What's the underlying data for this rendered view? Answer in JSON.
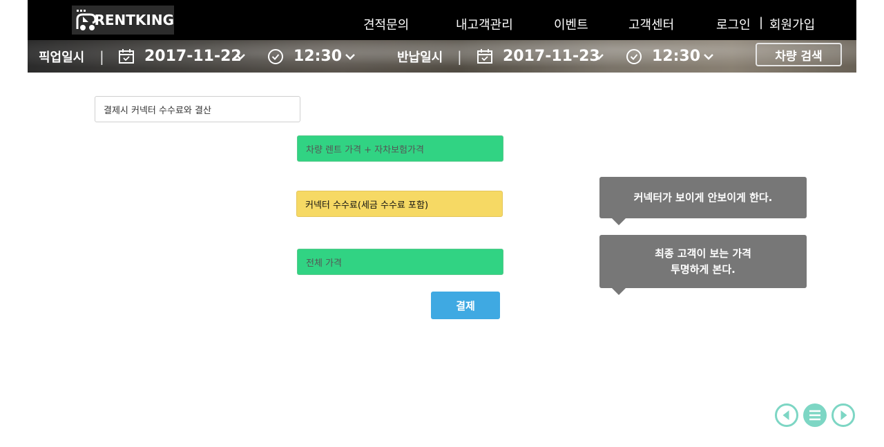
{
  "header": {
    "logo_text": "RENTKING",
    "nav": [
      {
        "label": "견적문의"
      },
      {
        "label": "내고객관리"
      },
      {
        "label": "이벤트"
      },
      {
        "label": "고객센터"
      }
    ],
    "login_label": "로그인",
    "signup_label": "회원가입",
    "auth_separator": "|"
  },
  "search": {
    "pickup_label": "픽업일시",
    "pickup_date": "2017-11-22",
    "pickup_time": "12:30",
    "return_label": "반납일시",
    "return_date": "2017-11-23",
    "return_time": "12:30",
    "separator": "|",
    "search_button": "차량 검색",
    "icons": [
      "calendar-icon",
      "chevron-down-icon",
      "clock-icon"
    ]
  },
  "main": {
    "title": "결제시 커넥터 수수료와 결산",
    "fields": [
      {
        "label": "차량 렌트 가격 + 자차보험가격",
        "color": "#31d383"
      },
      {
        "label": "커넥터 수수료(세금 수수료 포함)",
        "color": "#f6d964"
      },
      {
        "label": "전체 가격",
        "color": "#31d383"
      }
    ],
    "pay_button": "결제",
    "pay_button_color": "#3fa9e2"
  },
  "tooltips": [
    {
      "lines": [
        "커넥터가 보이게 안보이게 한다."
      ]
    },
    {
      "lines": [
        "최종 고객이 보는 가격",
        "투명하게 본다."
      ]
    }
  ],
  "controls": {
    "color": "#7dd6c4",
    "items": [
      "prev-icon",
      "menu-icon",
      "next-icon"
    ]
  }
}
